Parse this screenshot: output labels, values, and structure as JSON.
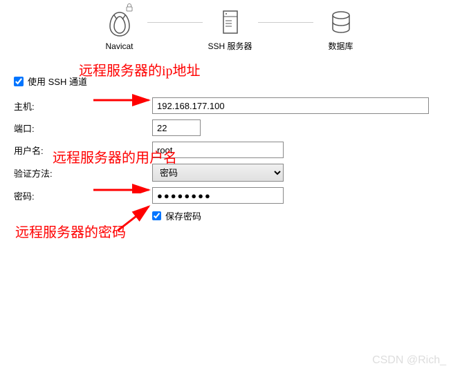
{
  "top": {
    "navicat_label": "Navicat",
    "ssh_label": "SSH 服务器",
    "db_label": "数据库"
  },
  "form": {
    "use_ssh_label": "使用 SSH 通道",
    "host_label": "主机:",
    "host_value": "192.168.177.100",
    "port_label": "端口:",
    "port_value": "22",
    "user_label": "用户名:",
    "user_value": "root",
    "auth_label": "验证方法:",
    "auth_value": "密码",
    "pass_label": "密码:",
    "pass_value": "●●●●●●●●",
    "save_pass_label": "保存密码"
  },
  "annotations": {
    "ip": "远程服务器的ip地址",
    "user": "远程服务器的用户名",
    "pass": "远程服务器的密码"
  },
  "watermark": "CSDN @Rich_"
}
